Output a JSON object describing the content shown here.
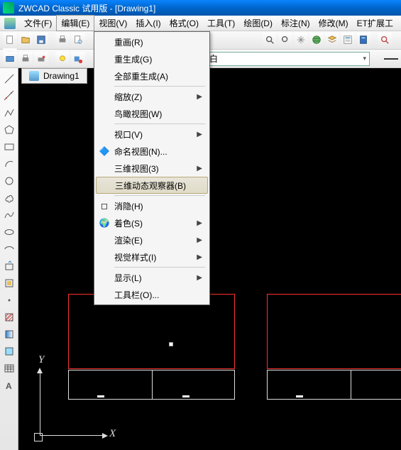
{
  "title": "ZWCAD Classic 试用版 - [Drawing1]",
  "menu": [
    "文件(F)",
    "编辑(E)",
    "视图(V)",
    "插入(I)",
    "格式(O)",
    "工具(T)",
    "绘图(D)",
    "标注(N)",
    "修改(M)",
    "ET扩展工"
  ],
  "dropdown": {
    "items": [
      {
        "label": "重画(R)",
        "sub": false,
        "icon": ""
      },
      {
        "label": "重生成(G)",
        "sub": false,
        "icon": ""
      },
      {
        "label": "全部重生成(A)",
        "sub": false,
        "icon": ""
      },
      {
        "sep": true
      },
      {
        "label": "缩放(Z)",
        "sub": true,
        "icon": ""
      },
      {
        "label": "鸟瞰视图(W)",
        "sub": false,
        "icon": ""
      },
      {
        "sep": true
      },
      {
        "label": "视口(V)",
        "sub": true,
        "icon": ""
      },
      {
        "label": "命名视图(N)...",
        "sub": false,
        "icon": "🔷"
      },
      {
        "label": "三维视图(3)",
        "sub": true,
        "icon": ""
      },
      {
        "label": "三维动态观察器(B)",
        "sub": false,
        "icon": "",
        "hl": true
      },
      {
        "sep": true
      },
      {
        "label": "消隐(H)",
        "sub": false,
        "icon": "◻"
      },
      {
        "label": "着色(S)",
        "sub": true,
        "icon": "🌍"
      },
      {
        "label": "渲染(E)",
        "sub": true,
        "icon": ""
      },
      {
        "label": "视觉样式(I)",
        "sub": true,
        "icon": ""
      },
      {
        "sep": true
      },
      {
        "label": "显示(L)",
        "sub": true,
        "icon": ""
      },
      {
        "label": "工具栏(O)...",
        "sub": false,
        "icon": ""
      }
    ]
  },
  "layer_selector": "口白",
  "doc_tab": "Drawing1",
  "axes": {
    "y": "Y",
    "x": "X"
  },
  "colors": {
    "accent": "#ff3030",
    "bg": "#000000"
  }
}
